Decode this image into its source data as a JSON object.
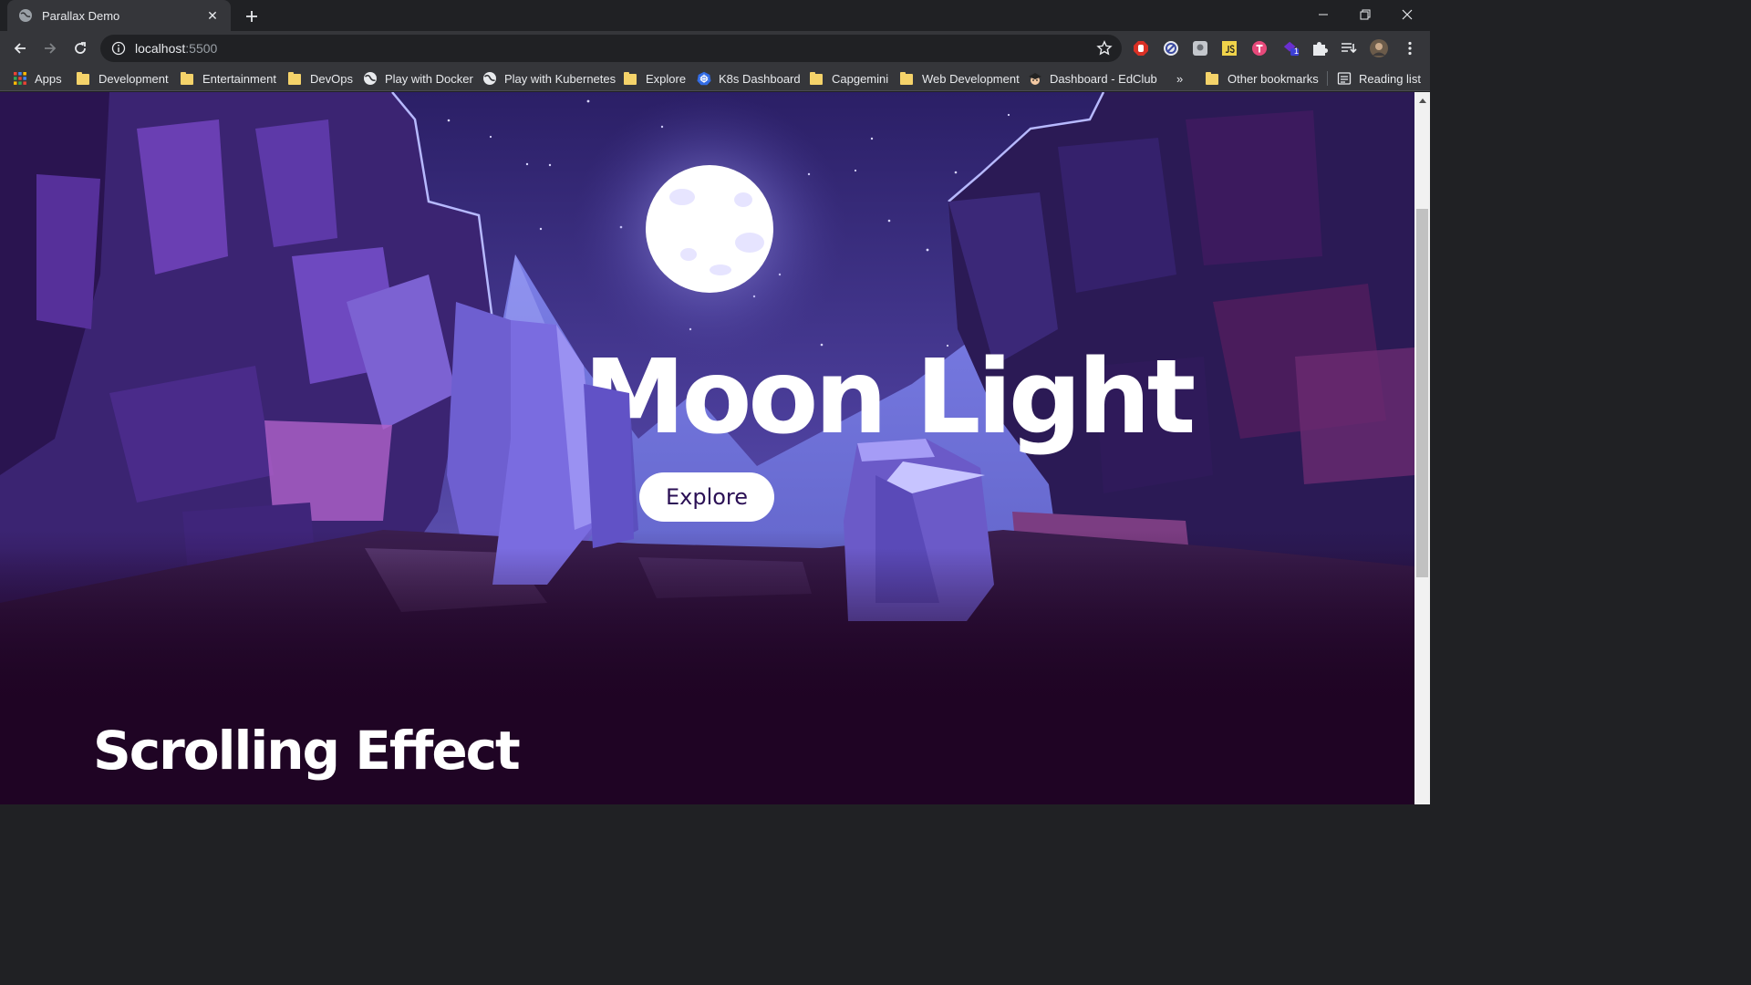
{
  "browser": {
    "tab": {
      "title": "Parallax Demo"
    },
    "address": {
      "host": "localhost",
      "port": ":5500"
    },
    "extensions": [
      "adblock-icon",
      "privacy-icon",
      "screenshot-icon",
      "js-icon",
      "t-icon",
      "badge-icon",
      "puzzle-icon",
      "reading-queue-icon",
      "profile-avatar"
    ],
    "extension_badge": "1"
  },
  "bookmarks": {
    "items": [
      {
        "label": "Apps",
        "icon": "apps-grid-icon"
      },
      {
        "label": "Development",
        "icon": "folder-icon"
      },
      {
        "label": "Entertainment",
        "icon": "folder-icon"
      },
      {
        "label": "DevOps",
        "icon": "folder-icon"
      },
      {
        "label": "Play with Docker",
        "icon": "globe-icon"
      },
      {
        "label": "Play with Kubernetes",
        "icon": "globe-icon"
      },
      {
        "label": "Explore",
        "icon": "folder-icon"
      },
      {
        "label": "K8s Dashboard",
        "icon": "kubernetes-icon"
      },
      {
        "label": "Capgemini",
        "icon": "folder-icon"
      },
      {
        "label": "Web Development",
        "icon": "folder-icon"
      },
      {
        "label": "Dashboard - EdClub",
        "icon": "edclub-icon"
      }
    ],
    "overflow": "»",
    "other": "Other bookmarks",
    "reading_list": "Reading list"
  },
  "page": {
    "hero_title": "Moon Light",
    "explore_button": "Explore",
    "section_title": "Scrolling Effect"
  },
  "colors": {
    "sky_top": "#2d1f6b",
    "sky_mid": "#5a4fb0",
    "moon": "#ffffff",
    "rock": "#4b2f8a",
    "page_bg": "#1f0424",
    "button_text": "#2b1055"
  }
}
